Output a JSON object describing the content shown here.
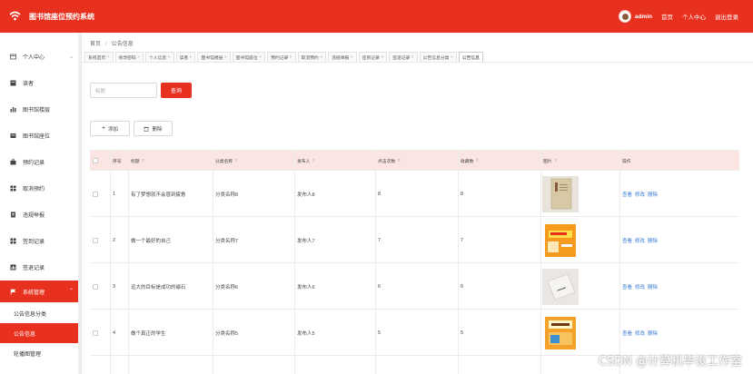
{
  "header": {
    "title": "图书馆座位预约系统",
    "username": "admin",
    "links": {
      "home": "首页",
      "profile": "个人中心",
      "logout": "退出登录"
    }
  },
  "colors": {
    "primary": "#e8301f",
    "table_header_bg": "#fbe5e3",
    "link": "#3a7bd5"
  },
  "sidebar": {
    "items": [
      {
        "label": "个人中心",
        "icon": "user-card-icon"
      },
      {
        "label": "读者",
        "icon": "book-icon"
      },
      {
        "label": "图书馆楼层",
        "icon": "bar-chart-icon"
      },
      {
        "label": "图书馆座位",
        "icon": "seat-icon"
      },
      {
        "label": "预约记录",
        "icon": "briefcase-icon"
      },
      {
        "label": "取消预约",
        "icon": "grid-icon"
      },
      {
        "label": "违规举报",
        "icon": "report-icon"
      },
      {
        "label": "签到记录",
        "icon": "grid-icon"
      },
      {
        "label": "签退记录",
        "icon": "chart-icon"
      },
      {
        "label": "系统管理",
        "icon": "flag-icon",
        "expanded": true
      }
    ],
    "subitems": [
      {
        "label": "公告信息分类"
      },
      {
        "label": "公告信息"
      },
      {
        "label": "轮播图管理"
      }
    ]
  },
  "breadcrumb": {
    "home": "首页",
    "separator": "/",
    "current": "公告信息"
  },
  "tabs": [
    "系统首页",
    "修改密码",
    "个人信息",
    "读者",
    "图书馆楼层",
    "图书馆座位",
    "预约记录",
    "取消预约",
    "违规举报",
    "签到记录",
    "签退记录",
    "公告信息分类",
    "公告信息"
  ],
  "active_tab": "公告信息",
  "search": {
    "placeholder": "标题",
    "button": "查询"
  },
  "actions": {
    "add": "添加",
    "delete": "删除"
  },
  "table": {
    "columns": [
      "序号",
      "标题",
      "分类名称",
      "发布人",
      "点击次数",
      "收藏数",
      "图片",
      "操作"
    ],
    "sortable": [
      false,
      true,
      true,
      true,
      true,
      true,
      true,
      false
    ],
    "rows": [
      {
        "index": "1",
        "title": "有了梦想就不会感到疲惫",
        "category": "分类名称8",
        "publisher": "发布人8",
        "clicks": "8",
        "favorites": "8"
      },
      {
        "index": "2",
        "title": "做一个最好的自己",
        "category": "分类名称7",
        "publisher": "发布人7",
        "clicks": "7",
        "favorites": "7"
      },
      {
        "index": "3",
        "title": "远大的目标是成功的磁石",
        "category": "分类名称6",
        "publisher": "发布人6",
        "clicks": "6",
        "favorites": "6"
      },
      {
        "index": "4",
        "title": "做个真正的学生",
        "category": "分类名称5",
        "publisher": "发布人5",
        "clicks": "5",
        "favorites": "5"
      }
    ],
    "ops": {
      "view": "查看",
      "edit": "修改",
      "delete": "删除"
    }
  },
  "watermark": "CSDN @计算机毕设工作室"
}
